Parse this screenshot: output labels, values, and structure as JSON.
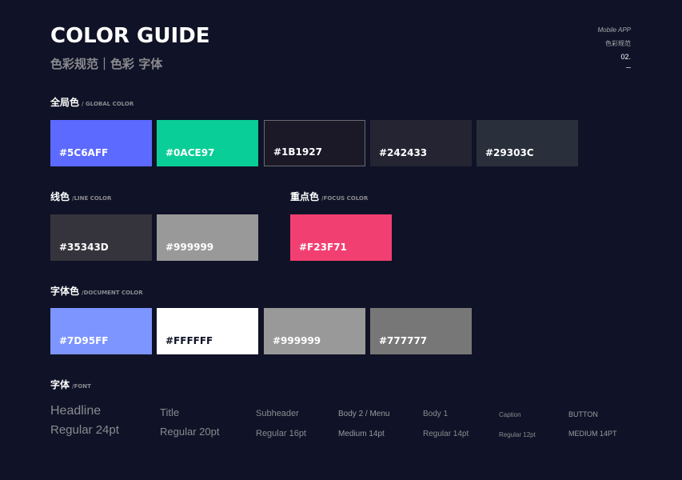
{
  "header": {
    "title": "COLOR GUIDE",
    "subtitle": "色彩规范｜色彩 字体",
    "meta_app": "Mobile APP",
    "meta_cn": "色彩规范",
    "meta_page": "02."
  },
  "global": {
    "title_cn": "全局色",
    "title_en": "/ GLOBAL COLOR",
    "swatches": [
      {
        "hex": "#5C6AFF",
        "color": "#5C6AFF",
        "text_color": "#FFFFFF"
      },
      {
        "hex": "#0ACE97",
        "color": "#0ACE97",
        "text_color": "#FFFFFF"
      },
      {
        "hex": "#1B1927",
        "color": "#1B1927",
        "text_color": "#FFFFFF"
      },
      {
        "hex": "#242433",
        "color": "#242433",
        "text_color": "#FFFFFF"
      },
      {
        "hex": "#29303C",
        "color": "#29303C",
        "text_color": "#FFFFFF"
      }
    ]
  },
  "line": {
    "title_cn": "线色",
    "title_en": "/LINE COLOR",
    "swatches": [
      {
        "hex": "#35343D",
        "color": "#35343D",
        "text_color": "#FFFFFF"
      },
      {
        "hex": "#999999",
        "color": "#999999",
        "text_color": "#FFFFFF"
      }
    ]
  },
  "focus": {
    "title_cn": "重点色",
    "title_en": "/FOCUS COLOR",
    "swatches": [
      {
        "hex": "#F23F71",
        "color": "#F23F71",
        "text_color": "#FFFFFF"
      }
    ]
  },
  "document": {
    "title_cn": "字体色",
    "title_en": "/DOCUMENT COLOR",
    "swatches": [
      {
        "hex": "#7D95FF",
        "color": "#7D95FF",
        "text_color": "#FFFFFF"
      },
      {
        "hex": "#FFFFFF",
        "color": "#FFFFFF",
        "text_color": "#101327"
      },
      {
        "hex": "#999999",
        "color": "#999999",
        "text_color": "#FFFFFF"
      },
      {
        "hex": "#777777",
        "color": "#777777",
        "text_color": "#FFFFFF"
      }
    ]
  },
  "font": {
    "title_cn": "字体",
    "title_en": "/FONT",
    "samples": [
      {
        "name": "Headline",
        "spec": "Regular 24pt"
      },
      {
        "name": "Title",
        "spec": "Regular 20pt"
      },
      {
        "name": "Subheader",
        "spec": "Regular 16pt"
      },
      {
        "name": "Body 2 / Menu",
        "spec": "Medium 14pt"
      },
      {
        "name": "Body 1",
        "spec": "Regular 14pt"
      },
      {
        "name": "Caption",
        "spec": "Regular 12pt"
      },
      {
        "name": "BUTTON",
        "spec": "MEDIUM 14PT"
      }
    ]
  }
}
